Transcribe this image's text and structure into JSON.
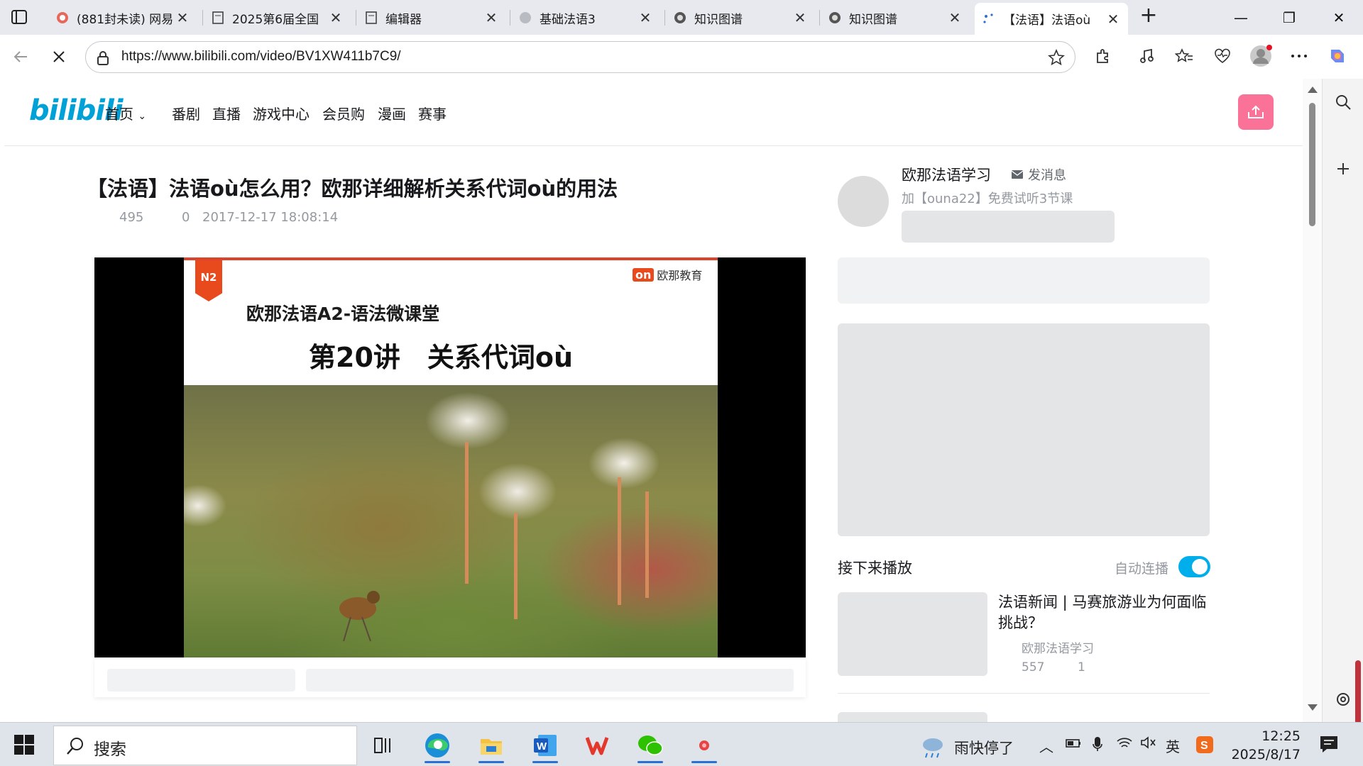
{
  "browser": {
    "tabs": [
      {
        "title": "(881封未读) 网易",
        "favicon": "mail-icon"
      },
      {
        "title": "2025第6届全国",
        "favicon": "page-icon"
      },
      {
        "title": "编辑器",
        "favicon": "page-icon"
      },
      {
        "title": "基础法语3",
        "favicon": "globe-icon"
      },
      {
        "title": "知识图谱",
        "favicon": "globe-icon"
      },
      {
        "title": "知识图谱",
        "favicon": "globe-icon"
      },
      {
        "title": "【法语】法语où",
        "favicon": "loading-icon",
        "active": true
      }
    ],
    "url": "https://www.bilibili.com/video/BV1XW411b7C9/"
  },
  "site": {
    "logo": "bilibili",
    "nav": [
      "首页",
      "番剧",
      "直播",
      "游戏中心",
      "会员购",
      "漫画",
      "赛事"
    ]
  },
  "video": {
    "title": "【法语】法语où怎么用？欧那详细解析关系代词où的用法",
    "views": "495",
    "danmaku": "0",
    "date": "2017-12-17 18:08:14",
    "slide": {
      "badge": "N2",
      "brand_mark": "on",
      "brand": "欧那教育",
      "subtitle": "欧那法语A2-语法微课堂",
      "heading": "第20讲　关系代词où"
    }
  },
  "uploader": {
    "name": "欧那法语学习",
    "message_label": "发消息",
    "description": "加【ouna22】免费试听3节课"
  },
  "up_next": {
    "heading": "接下来播放",
    "autoplay_label": "自动连播",
    "autoplay_on": true,
    "items": [
      {
        "title": "法语新闻 | 马赛旅游业为何面临挑战？",
        "author": "欧那法语学习",
        "views": "557",
        "danmaku": "1"
      }
    ]
  },
  "taskbar": {
    "search_placeholder": "搜索",
    "weather": "雨快停了",
    "ime": "英",
    "time": "12:25",
    "date": "2025/8/17"
  },
  "colors": {
    "bili_blue": "#00a1d6",
    "bili_pink": "#fb7299",
    "toggle": "#00aeec"
  }
}
